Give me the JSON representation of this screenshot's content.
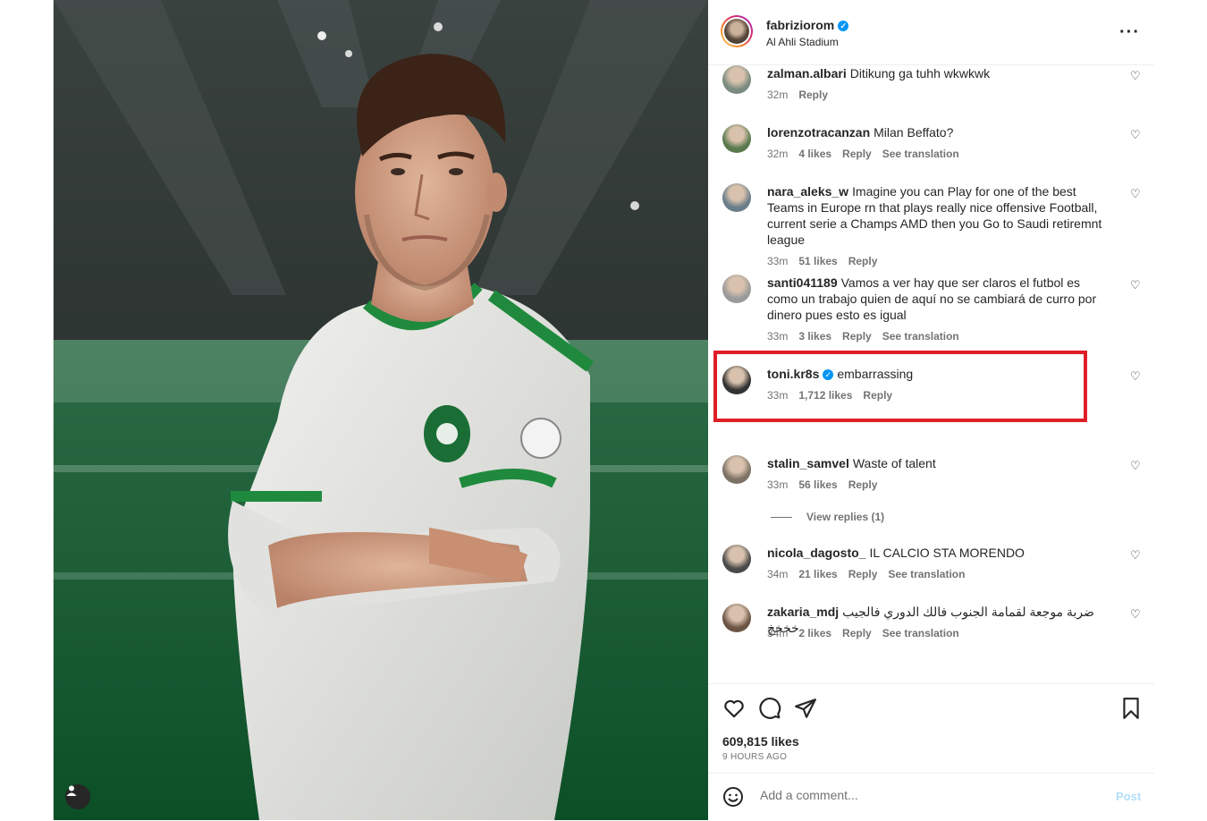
{
  "post": {
    "owner": "fabriziorom",
    "location": "Al Ahli Stadium",
    "more_icon": "more-options-icon",
    "likes": "609,815 likes",
    "time_ago": "9 HOURS AGO"
  },
  "comments": [
    {
      "user": "zalman.albari",
      "text": "Ditikung ga tuhh wkwkwk",
      "time": "32m",
      "likes": "",
      "reply": "Reply",
      "translation": "",
      "verified": false
    },
    {
      "user": "lorenzotracanzan",
      "text": "Milan Beffato?",
      "time": "32m",
      "likes": "4 likes",
      "reply": "Reply",
      "translation": "See translation",
      "verified": false
    },
    {
      "user": "nara_aleks_w",
      "text": "Imagine you can Play for one of the best Teams in Europe rn that plays really nice offensive Football, current serie a Champs AMD then you Go to Saudi retiremnt league",
      "time": "33m",
      "likes": "51 likes",
      "reply": "Reply",
      "translation": "",
      "verified": false
    },
    {
      "user": "santi041189",
      "text": "Vamos a ver hay que ser claros el futbol es como un trabajo quien de aquí no se cambiará de curro por dinero pues esto es igual",
      "time": "33m",
      "likes": "3 likes",
      "reply": "Reply",
      "translation": "See translation",
      "verified": false
    },
    {
      "user": "toni.kr8s",
      "text": "embarrassing",
      "time": "33m",
      "likes": "1,712 likes",
      "reply": "Reply",
      "translation": "",
      "verified": true
    },
    {
      "user": "stalin_samvel",
      "text": "Waste of talent",
      "time": "33m",
      "likes": "56 likes",
      "reply": "Reply",
      "translation": "",
      "verified": false
    },
    {
      "user": "nicola_dagosto_",
      "text": "IL CALCIO STA MORENDO",
      "time": "34m",
      "likes": "21 likes",
      "reply": "Reply",
      "translation": "See translation",
      "verified": false
    },
    {
      "user": "zakaria_mdj",
      "text": "ضربة موجعة لقمامة الجنوب فالك الدوري فالجيب خخخخ",
      "time": "34m",
      "likes": "2 likes",
      "reply": "Reply",
      "translation": "See translation",
      "verified": false
    }
  ],
  "view_replies": "View replies (1)",
  "add_comment": {
    "placeholder": "Add a comment...",
    "post_label": "Post"
  },
  "icons": {
    "like": "heart-icon",
    "comment": "comment-icon",
    "share": "send-icon",
    "save": "bookmark-icon",
    "emoji": "emoji-icon"
  },
  "colors": {
    "verified": "#0095f6",
    "highlight": "#e01e28",
    "post_disabled": "#b2dffc"
  }
}
